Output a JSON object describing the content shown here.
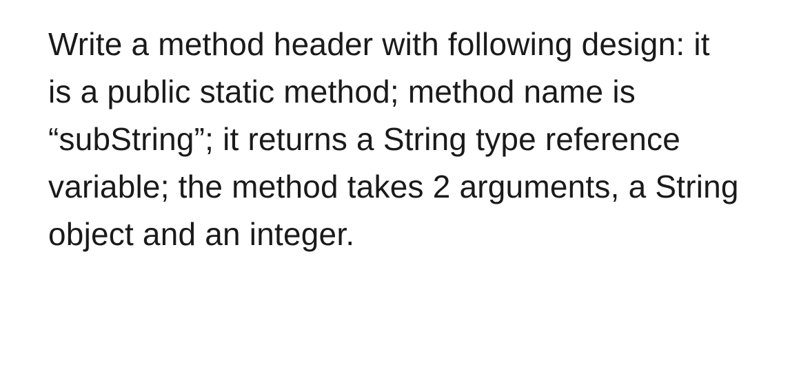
{
  "question": {
    "text": "Write a method header with following design: it is a public static method; method name is “subString”; it returns a String type reference variable; the method takes 2 arguments, a String object and an integer."
  }
}
